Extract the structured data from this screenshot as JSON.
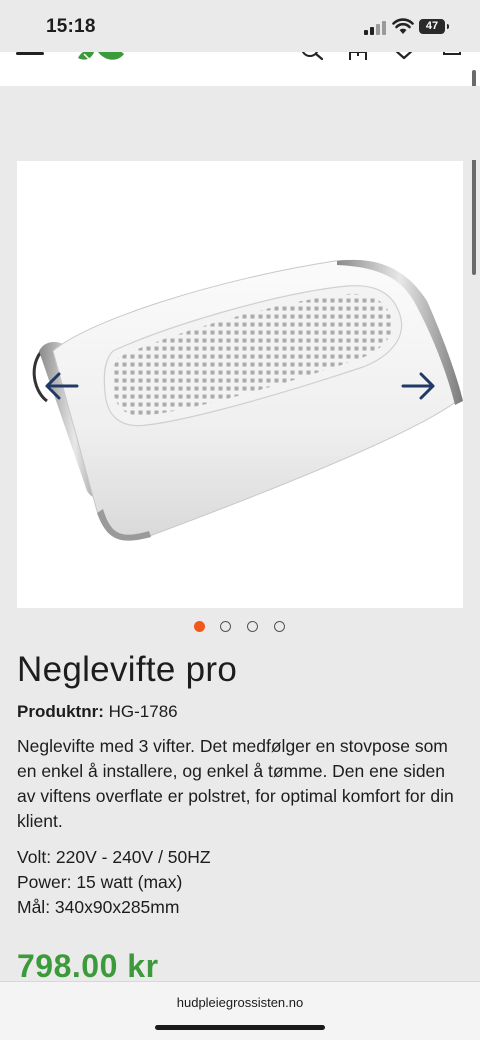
{
  "status_bar": {
    "time": "15:18",
    "battery": "47"
  },
  "product": {
    "title": "Neglevifte pro",
    "sku_label": "Produktnr:",
    "sku_value": "HG-1786",
    "description": "Neglevifte med 3 vifter. Det medfølger en stovpose som en enkel å installere, og enkel å tømme. Den ene siden av viftens overflate er polstret, for optimal komfort for din klient.",
    "specs": [
      "Volt: 220V - 240V / 50HZ",
      "Power: 15 watt (max)",
      "Mål: 340x90x285mm"
    ],
    "price": "798.00 kr"
  },
  "gallery": {
    "image_count": 4,
    "active_index": 0
  },
  "browser": {
    "url": "hudpleiegrossisten.no"
  },
  "colors": {
    "accent": "#ef5a1c",
    "price": "#3b9a3a",
    "arrow": "#1f3a66"
  }
}
